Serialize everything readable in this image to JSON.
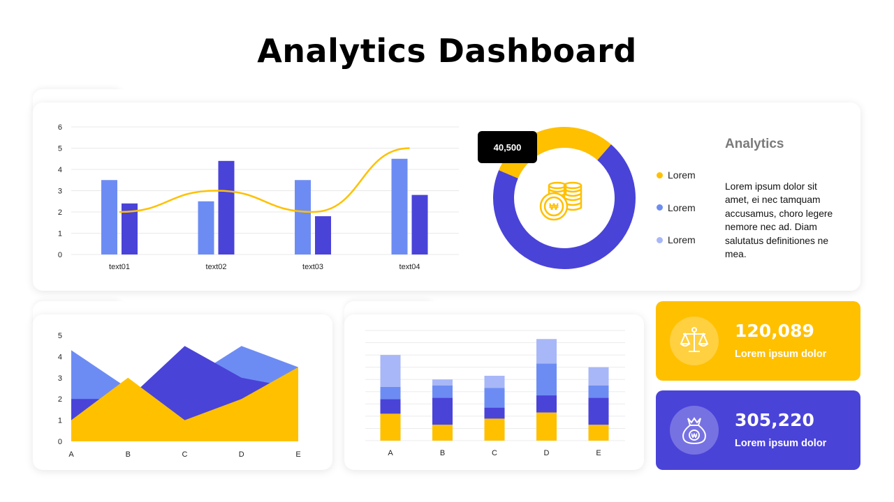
{
  "page": {
    "title": "Analytics Dashboard"
  },
  "colors": {
    "yellow": "#ffc000",
    "indigo": "#4a43d8",
    "blue": "#6d8cf3",
    "lightblue": "#a8b7f7"
  },
  "donut": {
    "badge": "40,500",
    "icon": "coins-icon",
    "legend": [
      "Lorem",
      "Lorem",
      "Lorem"
    ],
    "analytics_title": "Analytics",
    "analytics_text": "Lorem ipsum dolor sit amet, ei nec tamquam accusamus, choro legere nemore  nec ad. Diam salutatus definitiones ne mea."
  },
  "kpis": [
    {
      "value": "120,089",
      "label": "Lorem ipsum dolor",
      "icon": "balance-scale-icon",
      "color": "#ffc000"
    },
    {
      "value": "305,220",
      "label": "Lorem ipsum dolor",
      "icon": "money-bag-icon",
      "color": "#4a43d8"
    }
  ],
  "chart_data": [
    {
      "type": "bar",
      "categories": [
        "text01",
        "text02",
        "text03",
        "text04"
      ],
      "series": [
        {
          "values": [
            3.5,
            2.5,
            3.5,
            4.5
          ],
          "color": "#6d8cf3"
        },
        {
          "values": [
            2.4,
            4.4,
            1.8,
            2.8
          ],
          "color": "#4a43d8"
        },
        {
          "type": "line",
          "values": [
            2,
            3,
            2,
            5
          ],
          "color": "#ffc000"
        }
      ],
      "yticks": [
        0,
        1,
        2,
        3,
        4,
        5,
        6
      ],
      "ylim": [
        0,
        6
      ],
      "grid": true
    },
    {
      "type": "pie",
      "donut": true,
      "values": [
        30,
        70
      ],
      "colors": [
        "#ffc000",
        "#4a43d8"
      ]
    },
    {
      "type": "area",
      "categories": [
        "A",
        "B",
        "C",
        "D",
        "E"
      ],
      "series": [
        {
          "values": [
            4.3,
            2.5,
            2.8,
            4.5,
            3.5
          ],
          "color": "#6d8cf3"
        },
        {
          "values": [
            2,
            2,
            4.5,
            3,
            2.5
          ],
          "color": "#4a43d8"
        },
        {
          "values": [
            1,
            3,
            1,
            2,
            3.5
          ],
          "color": "#ffc000"
        }
      ],
      "yticks": [
        0,
        1,
        2,
        3,
        4,
        5
      ],
      "ylim": [
        0,
        5
      ],
      "grid": false
    },
    {
      "type": "bar",
      "stacked": true,
      "categories": [
        "A",
        "B",
        "C",
        "D",
        "E"
      ],
      "series": [
        {
          "values": [
            2.2,
            1.3,
            1.8,
            2.3,
            1.3
          ],
          "color": "#ffc000"
        },
        {
          "values": [
            1.2,
            2.2,
            0.9,
            1.4,
            2.2
          ],
          "color": "#4a43d8"
        },
        {
          "values": [
            1.0,
            1.0,
            1.6,
            2.6,
            1.0
          ],
          "color": "#6d8cf3"
        },
        {
          "values": [
            2.6,
            0.5,
            1.0,
            2.0,
            1.5
          ],
          "color": "#a8b7f7"
        }
      ],
      "ylim": [
        0,
        9
      ],
      "grid": true
    }
  ]
}
